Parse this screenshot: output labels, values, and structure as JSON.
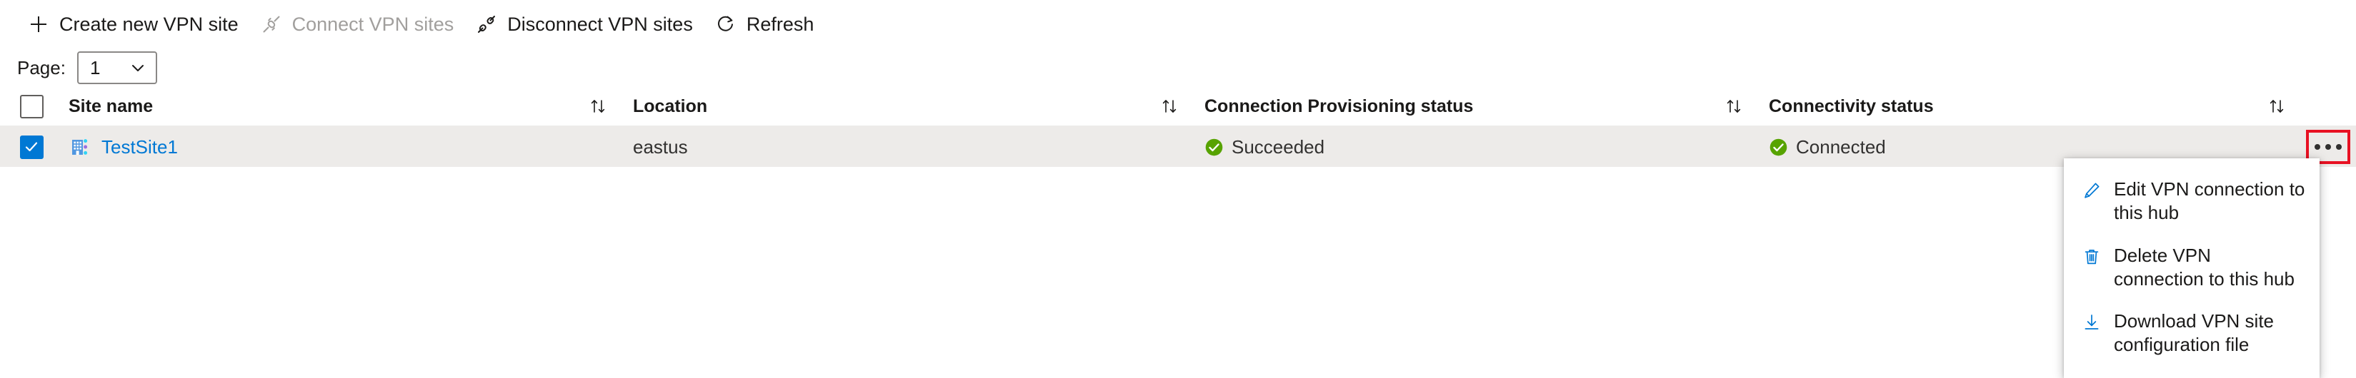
{
  "toolbar": {
    "buttons": [
      {
        "label": "Create new VPN site",
        "icon": "plus-icon",
        "disabled": false
      },
      {
        "label": "Connect VPN sites",
        "icon": "plug-connected-icon",
        "disabled": true
      },
      {
        "label": "Disconnect VPN sites",
        "icon": "plug-disconnected-icon",
        "disabled": false
      },
      {
        "label": "Refresh",
        "icon": "refresh-icon",
        "disabled": false
      }
    ]
  },
  "pager": {
    "label": "Page:",
    "value": "1",
    "options": [
      "1"
    ],
    "chevron": "chevron-down-icon"
  },
  "table": {
    "columns": [
      {
        "key": "site_name",
        "label": "Site name",
        "sortable": true
      },
      {
        "key": "location",
        "label": "Location",
        "sortable": true
      },
      {
        "key": "provisioning",
        "label": "Connection Provisioning status",
        "sortable": true
      },
      {
        "key": "connectivity",
        "label": "Connectivity status",
        "sortable": true
      }
    ],
    "header_checkbox_checked": false,
    "sort_icon": "sort-ascending-descending-icon",
    "rows": [
      {
        "selected": true,
        "site_icon": "vpn-site-icon",
        "site_name": "TestSite1",
        "location": "eastus",
        "provisioning": "Succeeded",
        "provisioning_state": "success",
        "connectivity": "Connected",
        "connectivity_state": "success",
        "menu_icon": "ellipsis-icon",
        "menu_highlighted": true
      }
    ]
  },
  "context_menu": {
    "visible": true,
    "items": [
      {
        "label": "Edit VPN connection to this hub",
        "icon": "pencil-icon"
      },
      {
        "label": "Delete VPN connection to this hub",
        "icon": "trash-icon"
      },
      {
        "label": "Download VPN site configuration file",
        "icon": "download-icon"
      }
    ]
  },
  "colors": {
    "accent": "#0078d4",
    "success": "#57a300",
    "row_selected_bg": "#edebe9",
    "highlight_box": "#e81123",
    "disabled_text": "#a19f9d"
  }
}
